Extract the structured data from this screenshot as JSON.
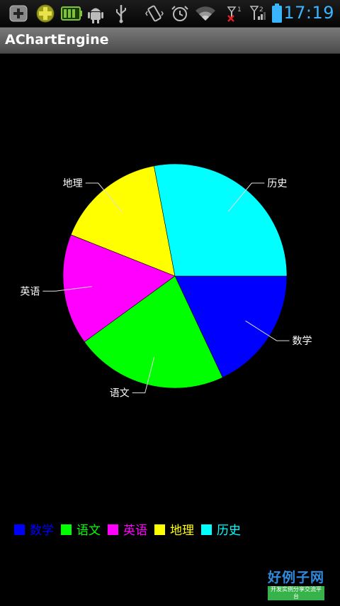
{
  "status_bar": {
    "time": "17:19",
    "icons": [
      "add-notification-icon",
      "game-icon",
      "battery-charging-icon",
      "android-debug-icon",
      "usb-icon",
      "vibrate-icon",
      "alarm-icon",
      "wifi-icon",
      "no-signal-icon",
      "signal-icon",
      "battery-icon"
    ],
    "signal_1": "1",
    "signal_2": "2",
    "accent": "#3ab4ff"
  },
  "app": {
    "title": "AChartEngine"
  },
  "chart_data": {
    "type": "pie",
    "title": "",
    "categories": [
      "数学",
      "语文",
      "英语",
      "地理",
      "历史"
    ],
    "values": [
      18,
      22,
      16,
      16,
      28
    ],
    "colors": [
      "#0000ff",
      "#00ff00",
      "#ff00ff",
      "#ffff00",
      "#00ffff"
    ],
    "start_angle": 0,
    "slice_separator_color": "#000000",
    "label_color": "#ffffff",
    "legend": "bottom-left"
  },
  "watermark": {
    "main": "好例子网",
    "sub": "开发实例分享交流平台"
  }
}
